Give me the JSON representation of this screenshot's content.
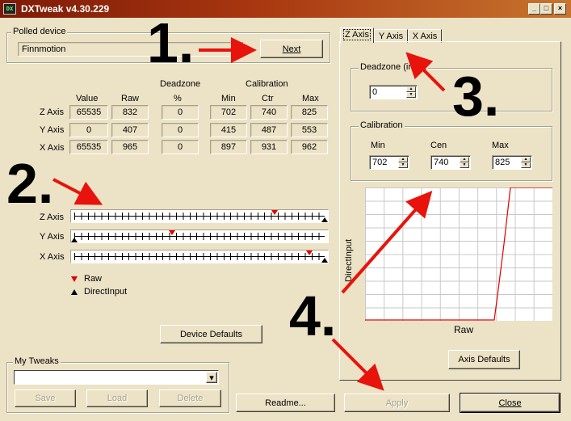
{
  "window": {
    "title": "DXTweak v4.30.229",
    "icon": "dx-app-icon"
  },
  "polled_device": {
    "group_title": "Polled device",
    "device_name": "Finnmotion",
    "next_label": "Next"
  },
  "axes_table": {
    "headers": {
      "value": "Value",
      "raw": "Raw",
      "deadzone": "Deadzone",
      "deadzone_unit": "%",
      "calibration": "Calibration",
      "min": "Min",
      "ctr": "Ctr",
      "max": "Max"
    },
    "rows": [
      {
        "label": "Z Axis",
        "value": "65535",
        "raw": "832",
        "deadzone": "0",
        "min": "702",
        "ctr": "740",
        "max": "825"
      },
      {
        "label": "Y Axis",
        "value": "0",
        "raw": "407",
        "deadzone": "0",
        "min": "415",
        "ctr": "487",
        "max": "553"
      },
      {
        "label": "X Axis",
        "value": "65535",
        "raw": "965",
        "deadzone": "0",
        "min": "897",
        "ctr": "931",
        "max": "962"
      }
    ]
  },
  "sliders": [
    {
      "label": "Z Axis",
      "raw_level": 0.8,
      "directinput_level": 1.0
    },
    {
      "label": "Y Axis",
      "raw_level": 0.39,
      "directinput_level": 0.0
    },
    {
      "label": "X Axis",
      "raw_level": 0.94,
      "directinput_level": 1.0
    }
  ],
  "legend": {
    "raw": "Raw",
    "directinput": "DirectInput"
  },
  "device_defaults_label": "Device Defaults",
  "my_tweaks": {
    "group_title": "My Tweaks",
    "selected": "",
    "save_label": "Save",
    "load_label": "Load",
    "delete_label": "Delete"
  },
  "bottom_buttons": {
    "readme": "Readme...",
    "apply": "Apply",
    "close": "Close"
  },
  "tabs": [
    {
      "label": "Z Axis",
      "active": true
    },
    {
      "label": "Y Axis",
      "active": false
    },
    {
      "label": "X Axis",
      "active": false
    }
  ],
  "axis_panel": {
    "deadzone_title": "Deadzone (in %)",
    "deadzone_value": "0",
    "calibration_title": "Calibration",
    "min_label": "Min",
    "min_value": "702",
    "cen_label": "Cen",
    "cen_value": "740",
    "max_label": "Max",
    "max_value": "825",
    "graph_ylabel": "DirectInput",
    "graph_xlabel": "Raw",
    "axis_defaults_label": "Axis Defaults"
  },
  "annotations": {
    "step1": "1.",
    "step2": "2.",
    "step3": "3.",
    "step4": "4.",
    "arrow_color": "#E8130C"
  },
  "colors": {
    "title_start": "#7D1A06",
    "title_end": "#C7752E",
    "face": "#ECE2C6",
    "curve": "#E00000"
  }
}
